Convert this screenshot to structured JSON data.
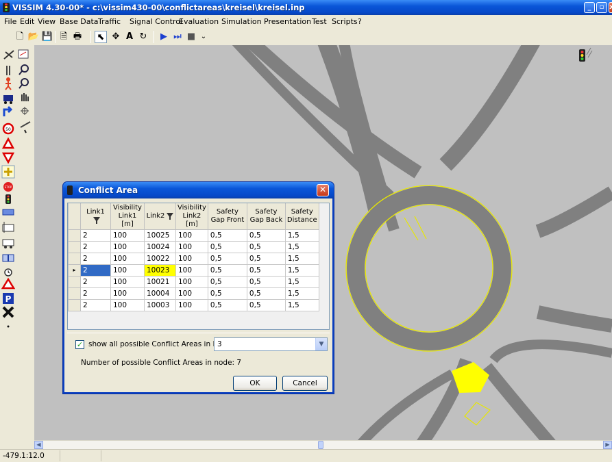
{
  "window": {
    "title": "VISSIM 4.30-00* - c:\\vissim430-00\\conflictareas\\kreisel\\kreisel.inp",
    "min_glyph": "_",
    "max_glyph": "▫",
    "close_glyph": "x"
  },
  "menu": [
    "File",
    "Edit",
    "View",
    "Base Data",
    "Traffic",
    "Signal Control",
    "Evaluation",
    "Simulation",
    "Presentation",
    "Test",
    "Scripts",
    "?"
  ],
  "toolbar": {
    "new": "🗋",
    "open": "📂",
    "save": "💾",
    "preview": "🗎",
    "print": "🖶",
    "select": "⬉",
    "pan": "✥",
    "text": "A",
    "rotate": "↻",
    "run": "▶",
    "step": "⏭",
    "stop": "■",
    "more": "⌄"
  },
  "dialog": {
    "title": "Conflict Area",
    "close_glyph": "✕",
    "columns": [
      "Link1",
      "Visibility Link1 [m]",
      "Link2",
      "Visibility Link2 [m]",
      "Safety Gap Front",
      "Safety Gap Back",
      "Safety Distance"
    ],
    "rows": [
      [
        "2",
        "100",
        "10025",
        "100",
        "0,5",
        "0,5",
        "1,5"
      ],
      [
        "2",
        "100",
        "10024",
        "100",
        "0,5",
        "0,5",
        "1,5"
      ],
      [
        "2",
        "100",
        "10022",
        "100",
        "0,5",
        "0,5",
        "1,5"
      ],
      [
        "2",
        "100",
        "10023",
        "100",
        "0,5",
        "0,5",
        "1,5"
      ],
      [
        "2",
        "100",
        "10021",
        "100",
        "0,5",
        "0,5",
        "1,5"
      ],
      [
        "2",
        "100",
        "10004",
        "100",
        "0,5",
        "0,5",
        "1,5"
      ],
      [
        "2",
        "100",
        "10003",
        "100",
        "0,5",
        "0,5",
        "1,5"
      ]
    ],
    "selected_row": 3,
    "row_pointer": "▸",
    "check_label": "show all possible Conflict Areas in Node:",
    "check_mark": "✓",
    "node_value": "3",
    "count_label": "Number of possible Conflict Areas in node:  7",
    "ok": "OK",
    "cancel": "Cancel"
  },
  "status": {
    "coords": "-479.1:12.0"
  },
  "colors": {
    "road": "#808080",
    "background": "#c0c0c0",
    "conflict_area": "#ffff00",
    "selected_cell": "#316ac5"
  }
}
